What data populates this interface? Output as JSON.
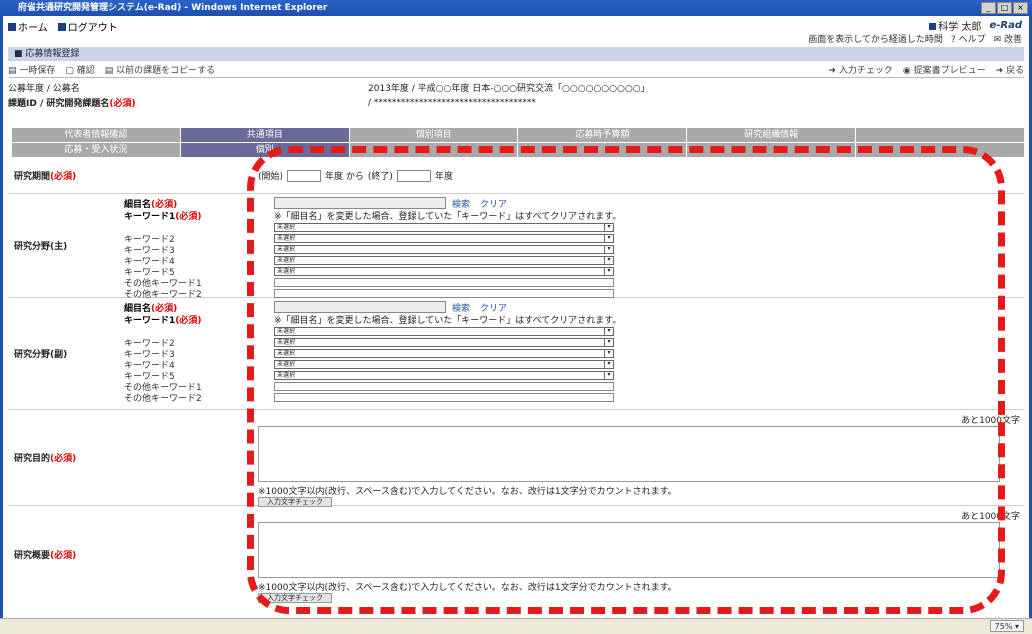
{
  "window": {
    "title": "府省共通研究開発管理システム(e-Rad) - Windows Internet Explorer",
    "min": "_",
    "max": "□",
    "close": "×"
  },
  "nav": {
    "home": "ホーム",
    "logout": "ログアウト"
  },
  "user": {
    "name": "科学 太郎",
    "logo": "e-Rad"
  },
  "timebar": {
    "elapsed": "画面を表示してから経過した時間",
    "help": "ヘルプ",
    "change": "改善"
  },
  "section": {
    "title": "応募情報登録"
  },
  "toolbar": {
    "tempsave": "一時保存",
    "confirm": "確認",
    "copy": "以前の課題をコピーする",
    "input_check": "入力チェック",
    "preview": "提案書プレビュー",
    "back": "戻る"
  },
  "info": {
    "koubo_label": "公募年度 / 公募名",
    "koubo_value": "2013年度 / 平成○○年度 日本-○○○研究交流「○○○○○○○○○○」",
    "kadai_label": "課題ID / 研究開発課題名",
    "required": "(必須)",
    "kadai_value": "/ ************************************"
  },
  "tabs": [
    "代表者情報確認",
    "共通項目",
    "個別項目",
    "応募時予算額",
    "研究組織情報",
    "",
    "応募・受入状況",
    "個別",
    "",
    "",
    "",
    ""
  ],
  "period": {
    "label": "研究期間",
    "req": "(必須)",
    "start": "(開始)",
    "from": "年度 から",
    "end": "(終了)",
    "nendo": "年度"
  },
  "main_field": {
    "label": "研究分野(主)",
    "saimoku": "細目名",
    "req": "(必須)",
    "search": "検索",
    "clear": "クリア",
    "notice": "※「細目名」を変更した場合、登録していた「キーワード」はすべてクリアされます。",
    "kw1": "キーワード1",
    "keywords": [
      "キーワード2",
      "キーワード3",
      "キーワード4",
      "キーワード5"
    ],
    "sel": "未選択",
    "other1": "その他キーワード1",
    "other2": "その他キーワード2"
  },
  "sub_field": {
    "label": "研究分野(副)"
  },
  "purpose": {
    "label": "研究目的",
    "req": "(必須)",
    "remaining": "あと1000文字",
    "note": "※1000文字以内(改行、スペース含む)で入力してください。なお、改行は1文字分でカウントされます。",
    "btn": "入力文字チェック"
  },
  "summary": {
    "label": "研究概要",
    "req": "(必須)",
    "remaining": "あと1000文字",
    "note": "※1000文字以内(改行、スペース含む)で入力してください。なお、改行は1文字分でカウントされます。",
    "btn": "入力文字チェック"
  },
  "status": {
    "zoom": "75%"
  }
}
